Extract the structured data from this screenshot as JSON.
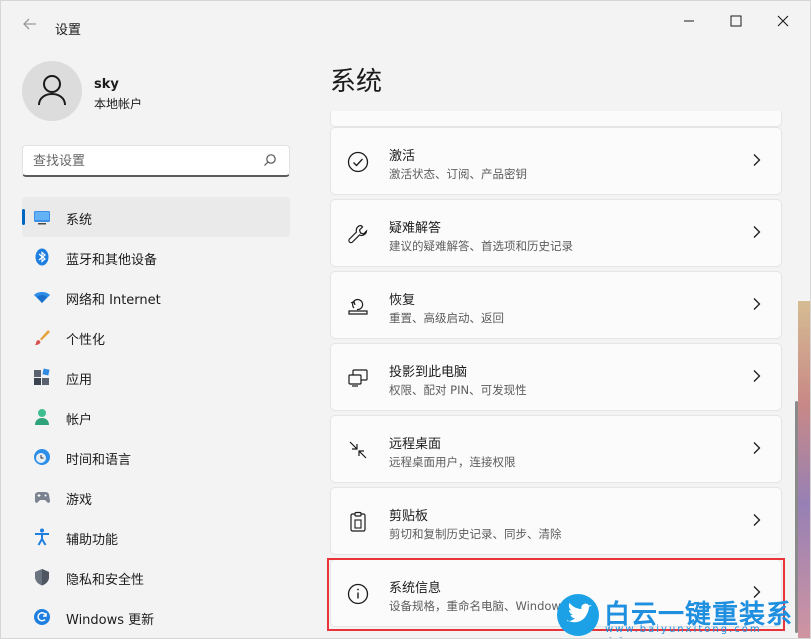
{
  "window": {
    "title": "设置",
    "back_icon": "back-arrow-icon",
    "minimize": "—",
    "maximize": "☐",
    "close": "✕"
  },
  "user": {
    "name": "sky",
    "account_type": "本地帐户"
  },
  "search": {
    "placeholder": "查找设置"
  },
  "nav": {
    "items": [
      {
        "label": "系统",
        "icon": "monitor-icon",
        "active": true
      },
      {
        "label": "蓝牙和其他设备",
        "icon": "bluetooth-icon"
      },
      {
        "label": "网络和 Internet",
        "icon": "wifi-icon"
      },
      {
        "label": "个性化",
        "icon": "brush-icon"
      },
      {
        "label": "应用",
        "icon": "apps-icon"
      },
      {
        "label": "帐户",
        "icon": "account-icon"
      },
      {
        "label": "时间和语言",
        "icon": "clock-globe-icon"
      },
      {
        "label": "游戏",
        "icon": "gamepad-icon"
      },
      {
        "label": "辅助功能",
        "icon": "accessibility-icon"
      },
      {
        "label": "隐私和安全性",
        "icon": "shield-icon"
      },
      {
        "label": "Windows 更新",
        "icon": "update-icon"
      }
    ]
  },
  "main": {
    "title": "系统",
    "cards": [
      {
        "title": "激活",
        "desc": "激活状态、订阅、产品密钥",
        "icon": "check-circle-icon"
      },
      {
        "title": "疑难解答",
        "desc": "建议的疑难解答、首选项和历史记录",
        "icon": "wrench-icon"
      },
      {
        "title": "恢复",
        "desc": "重置、高级启动、返回",
        "icon": "recovery-icon"
      },
      {
        "title": "投影到此电脑",
        "desc": "权限、配对 PIN、可发现性",
        "icon": "project-icon"
      },
      {
        "title": "远程桌面",
        "desc": "远程桌面用户，连接权限",
        "icon": "remote-desktop-icon"
      },
      {
        "title": "剪贴板",
        "desc": "剪切和复制历史记录、同步、清除",
        "icon": "clipboard-icon"
      },
      {
        "title": "系统信息",
        "desc": "设备规格，重命名电脑、Window",
        "icon": "info-icon",
        "highlighted": true
      }
    ]
  },
  "watermark": {
    "text": "白云一键重装系统",
    "url": "www.baiyunxitong.com"
  },
  "colors": {
    "accent": "#0067c0",
    "highlight": "#e8333a"
  }
}
